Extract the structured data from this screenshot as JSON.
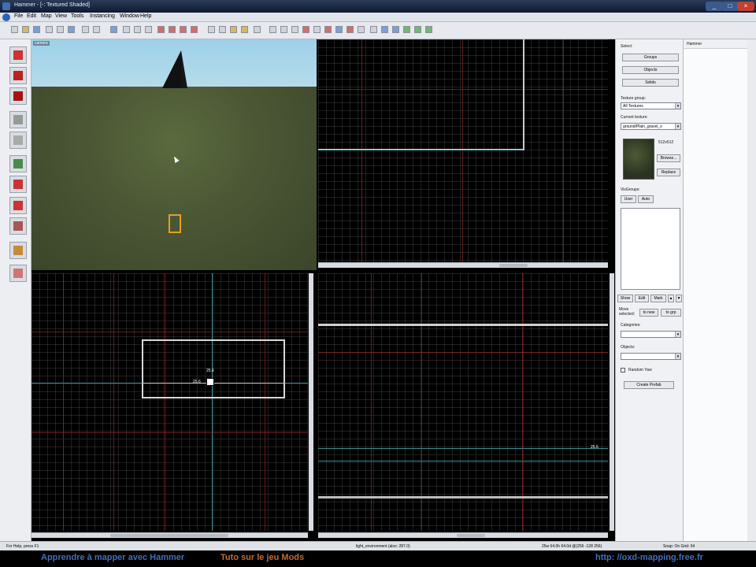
{
  "window": {
    "title": "Hammer - [-: Textured Shaded]"
  },
  "menu": [
    "File",
    "Edit",
    "Map",
    "View",
    "Tools",
    "Instancing",
    "Window",
    "Help"
  ],
  "viewports": {
    "camera_label": "camera",
    "top_label": "",
    "front_label": "",
    "side_label": ""
  },
  "brush_size": {
    "width": "25.6",
    "height": "25.6"
  },
  "right_panel": {
    "select_label": "Select:",
    "select_buttons": [
      "Groups",
      "Objects",
      "Solids"
    ],
    "texture_group_label": "Texture group:",
    "texture_group_value": "All Textures",
    "current_texture_label": "Current texture:",
    "current_texture_value": "ground/Plain_gravel_s",
    "texture_size": "512x512",
    "browse_label": "Browse...",
    "replace_label": "Replace",
    "visgroups_label": "VisGroups:",
    "tabs": [
      "User",
      "Auto"
    ],
    "vis_buttons": [
      "Show",
      "Edit",
      "Mark"
    ],
    "move_selected_label": "Move selected:",
    "move_buttons": [
      "to new",
      "to grp"
    ],
    "categories_label": "Categories:",
    "objects_label": "Objects:",
    "random_yaw_label": "Random Yaw",
    "create_prefab_label": "Create Prefab"
  },
  "farright_header": "Hammer",
  "status": {
    "help": "For Help, press F1",
    "entity": "light_environment  (also: 287.0)",
    "coords": "25w 64.0h 64.0d @(256 -128 256)",
    "snap": "Snap: On Grid: 64"
  },
  "banner": {
    "text1": "Apprendre à mapper avec Hammer",
    "text2": "Tuto sur le jeu Mods",
    "text3": "http: //oxd-mapping.free.fr"
  }
}
